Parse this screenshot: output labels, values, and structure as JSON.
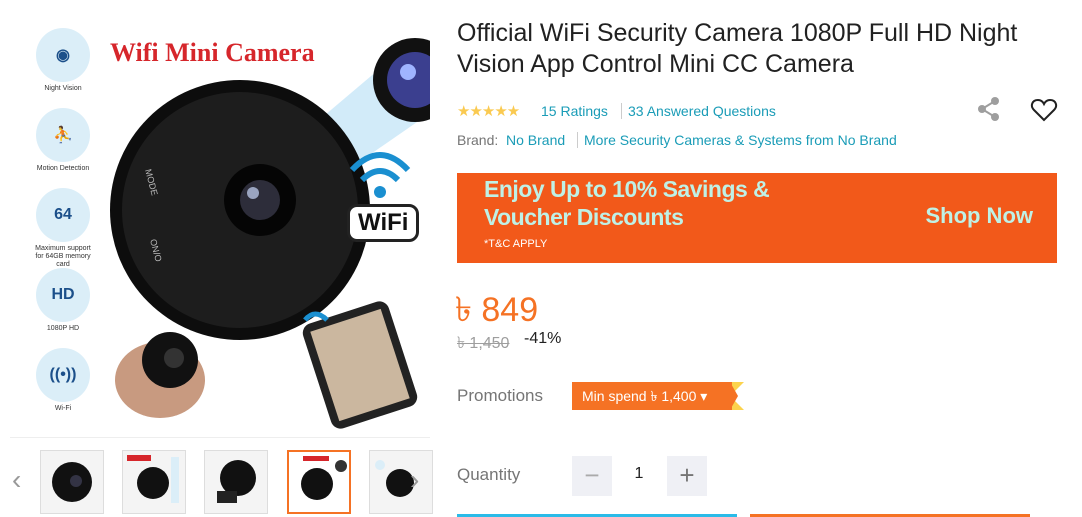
{
  "product": {
    "title": "Official WiFi Security Camera 1080P Full HD Night Vision App Control Mini CC Camera",
    "stars": "★★★★★",
    "ratings": "15 Ratings",
    "answered": "33 Answered Questions",
    "brand_label": "Brand:",
    "brand": "No Brand",
    "more_link": "More Security Cameras & Systems from No Brand"
  },
  "image": {
    "title": "Wifi Mini Camera",
    "features": [
      {
        "icon": "eye-icon",
        "glyph": "◉",
        "label": "Night Vision"
      },
      {
        "icon": "motion-detection-icon",
        "glyph": "⛹",
        "label": "Motion Detection"
      },
      {
        "icon": "memory-card-icon",
        "glyph": "64",
        "label": "Maximum support for 64GB memory card"
      },
      {
        "icon": "hd-icon",
        "glyph": "HD",
        "label": "1080P HD"
      },
      {
        "icon": "wifi-signal-icon",
        "glyph": "((•))",
        "label": "Wi-Fi"
      }
    ],
    "wifi_badge": "WiFi",
    "camera_labels": {
      "mode": "MODE",
      "on": "ON/O"
    }
  },
  "banner": {
    "line1": "Enjoy Up to 10% Savings &",
    "line2": "Voucher Discounts",
    "terms": "*T&C APPLY",
    "cta": "Shop Now"
  },
  "price": {
    "current": "৳ 849",
    "original": "৳ 1,450",
    "discount": "-41%"
  },
  "promotions": {
    "label": "Promotions",
    "chip": "Min spend ৳ 1,400  ▾"
  },
  "quantity": {
    "label": "Quantity",
    "value": "1",
    "minus": "−",
    "plus": "+"
  },
  "nav": {
    "prev": "‹",
    "next": "›"
  },
  "colors": {
    "accent": "#f57224",
    "link": "#1a9cb7",
    "star": "#faca51",
    "banner_text": "#bff1e6"
  }
}
